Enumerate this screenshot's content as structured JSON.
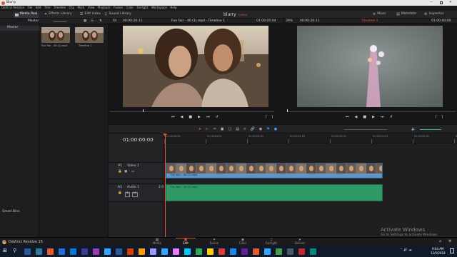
{
  "app": {
    "window_title": "Blurry",
    "project_name": "blurry",
    "project_status": "Edited",
    "brand": "DaVinci Resolve 15"
  },
  "menu": [
    "DaVinci Resolve",
    "File",
    "Edit",
    "Trim",
    "Timeline",
    "Clip",
    "Mark",
    "View",
    "Playback",
    "Fusion",
    "Color",
    "Fairlight",
    "Workspace",
    "Help"
  ],
  "toolbar": {
    "left": [
      "Media Pool",
      "Effects Library",
      "Edit Index",
      "Sound Library"
    ],
    "right": [
      "Mixer",
      "Metadata",
      "Inspector"
    ]
  },
  "media_pool": {
    "root_bin": "Master",
    "bins_header": "Master",
    "smart_bins": "Smart Bins",
    "clips": [
      {
        "name": "Fun Fair - 40 (1).mp4"
      },
      {
        "name": "Timeline 1"
      }
    ]
  },
  "source_viewer": {
    "fit": "Fit",
    "timecode_left": "00:00:20:11",
    "clip_name": "Fun Fair - 40 (1).mp4 - Timeline 1",
    "timecode_right": "01:00:05:04"
  },
  "timeline_viewer": {
    "zoom": "39%",
    "timecode_left": "00:00:20:11",
    "timeline_name": "Timeline 1",
    "timecode_right": "01:00:00:00"
  },
  "timeline": {
    "current_timecode": "01:00:00:00",
    "ruler": [
      "01:00:00:00",
      "01:00:04:22",
      "01:00:09:20",
      "01:00:14:18",
      "01:00:19:15",
      "01:00:24:13",
      "01:00:29:10",
      "01:00:34:08"
    ],
    "tracks": [
      {
        "id": "V1",
        "name": "Video 1",
        "clip": "Fun Fair - 40 (1).mp4"
      },
      {
        "id": "A1",
        "name": "Audio 1",
        "level": "2.0",
        "clip": "Fun Fair - 40 (1).mp4"
      }
    ]
  },
  "pages": [
    "Media",
    "Edit",
    "Fusion",
    "Color",
    "Fairlight",
    "Deliver"
  ],
  "active_page": "Edit",
  "watermark": {
    "title": "Activate Windows",
    "subtitle": "Go to Settings to activate Windows."
  },
  "taskbar": {
    "time": "9:04 AM",
    "date": "12/5/2018"
  },
  "colors": {
    "accent": "#e55b2a",
    "video_clip": "#5d95c9",
    "audio_clip": "#2f9a67",
    "playhead": "#e8553a"
  }
}
